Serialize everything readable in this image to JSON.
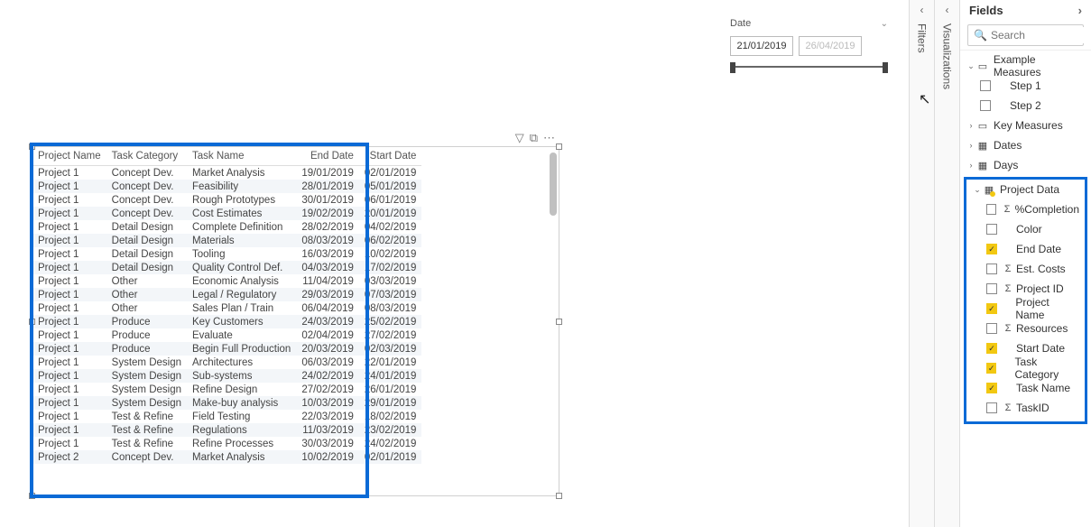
{
  "slicer": {
    "title": "Date",
    "start": "21/01/2019",
    "end": "26/04/2019"
  },
  "table": {
    "headers": [
      "Project Name",
      "Task Category",
      "Task Name",
      "End Date",
      "Start Date"
    ],
    "rows": [
      [
        "Project 1",
        "Concept Dev.",
        "Market Analysis",
        "19/01/2019",
        "02/01/2019"
      ],
      [
        "Project 1",
        "Concept Dev.",
        "Feasibility",
        "28/01/2019",
        "05/01/2019"
      ],
      [
        "Project 1",
        "Concept Dev.",
        "Rough Prototypes",
        "30/01/2019",
        "06/01/2019"
      ],
      [
        "Project 1",
        "Concept Dev.",
        "Cost Estimates",
        "19/02/2019",
        "20/01/2019"
      ],
      [
        "Project 1",
        "Detail Design",
        "Complete Definition",
        "28/02/2019",
        "04/02/2019"
      ],
      [
        "Project 1",
        "Detail Design",
        "Materials",
        "08/03/2019",
        "06/02/2019"
      ],
      [
        "Project 1",
        "Detail Design",
        "Tooling",
        "16/03/2019",
        "10/02/2019"
      ],
      [
        "Project 1",
        "Detail Design",
        "Quality Control Def.",
        "04/03/2019",
        "17/02/2019"
      ],
      [
        "Project 1",
        "Other",
        "Economic Analysis",
        "11/04/2019",
        "03/03/2019"
      ],
      [
        "Project 1",
        "Other",
        "Legal / Regulatory",
        "29/03/2019",
        "07/03/2019"
      ],
      [
        "Project 1",
        "Other",
        "Sales Plan / Train",
        "06/04/2019",
        "08/03/2019"
      ],
      [
        "Project 1",
        "Produce",
        "Key Customers",
        "24/03/2019",
        "25/02/2019"
      ],
      [
        "Project 1",
        "Produce",
        "Evaluate",
        "02/04/2019",
        "27/02/2019"
      ],
      [
        "Project 1",
        "Produce",
        "Begin Full Production",
        "20/03/2019",
        "02/03/2019"
      ],
      [
        "Project 1",
        "System Design",
        "Architectures",
        "06/03/2019",
        "22/01/2019"
      ],
      [
        "Project 1",
        "System Design",
        "Sub-systems",
        "24/02/2019",
        "24/01/2019"
      ],
      [
        "Project 1",
        "System Design",
        "Refine Design",
        "27/02/2019",
        "26/01/2019"
      ],
      [
        "Project 1",
        "System Design",
        "Make-buy analysis",
        "10/03/2019",
        "29/01/2019"
      ],
      [
        "Project 1",
        "Test & Refine",
        "Field Testing",
        "22/03/2019",
        "18/02/2019"
      ],
      [
        "Project 1",
        "Test & Refine",
        "Regulations",
        "11/03/2019",
        "23/02/2019"
      ],
      [
        "Project 1",
        "Test & Refine",
        "Refine Processes",
        "30/03/2019",
        "24/02/2019"
      ],
      [
        "Project 2",
        "Concept Dev.",
        "Market Analysis",
        "10/02/2019",
        "02/01/2019"
      ]
    ]
  },
  "panes": {
    "filters": "Filters",
    "visualizations": "Visualizations",
    "fields_title": "Fields",
    "search_placeholder": "Search"
  },
  "fields_tree": {
    "tables": [
      {
        "name": "Example Measures",
        "icon": "measure",
        "expanded": true,
        "fields": [
          {
            "name": "Step 1",
            "checked": false,
            "sigma": false
          },
          {
            "name": "Step 2",
            "checked": false,
            "sigma": false
          }
        ]
      },
      {
        "name": "Key Measures",
        "icon": "measure",
        "expanded": false
      },
      {
        "name": "Dates",
        "icon": "table",
        "expanded": false
      },
      {
        "name": "Days",
        "icon": "table",
        "expanded": false
      }
    ],
    "highlighted_table": {
      "name": "Project Data",
      "icon": "table",
      "expanded": true,
      "dotted": true,
      "fields": [
        {
          "name": "%Completion",
          "checked": false,
          "sigma": true
        },
        {
          "name": "Color",
          "checked": false,
          "sigma": false
        },
        {
          "name": "End Date",
          "checked": true,
          "sigma": false
        },
        {
          "name": "Est. Costs",
          "checked": false,
          "sigma": true
        },
        {
          "name": "Project ID",
          "checked": false,
          "sigma": true
        },
        {
          "name": "Project Name",
          "checked": true,
          "sigma": false
        },
        {
          "name": "Resources",
          "checked": false,
          "sigma": true
        },
        {
          "name": "Start Date",
          "checked": true,
          "sigma": false
        },
        {
          "name": "Task Category",
          "checked": true,
          "sigma": false
        },
        {
          "name": "Task Name",
          "checked": true,
          "sigma": false
        },
        {
          "name": "TaskID",
          "checked": false,
          "sigma": true
        }
      ]
    }
  }
}
